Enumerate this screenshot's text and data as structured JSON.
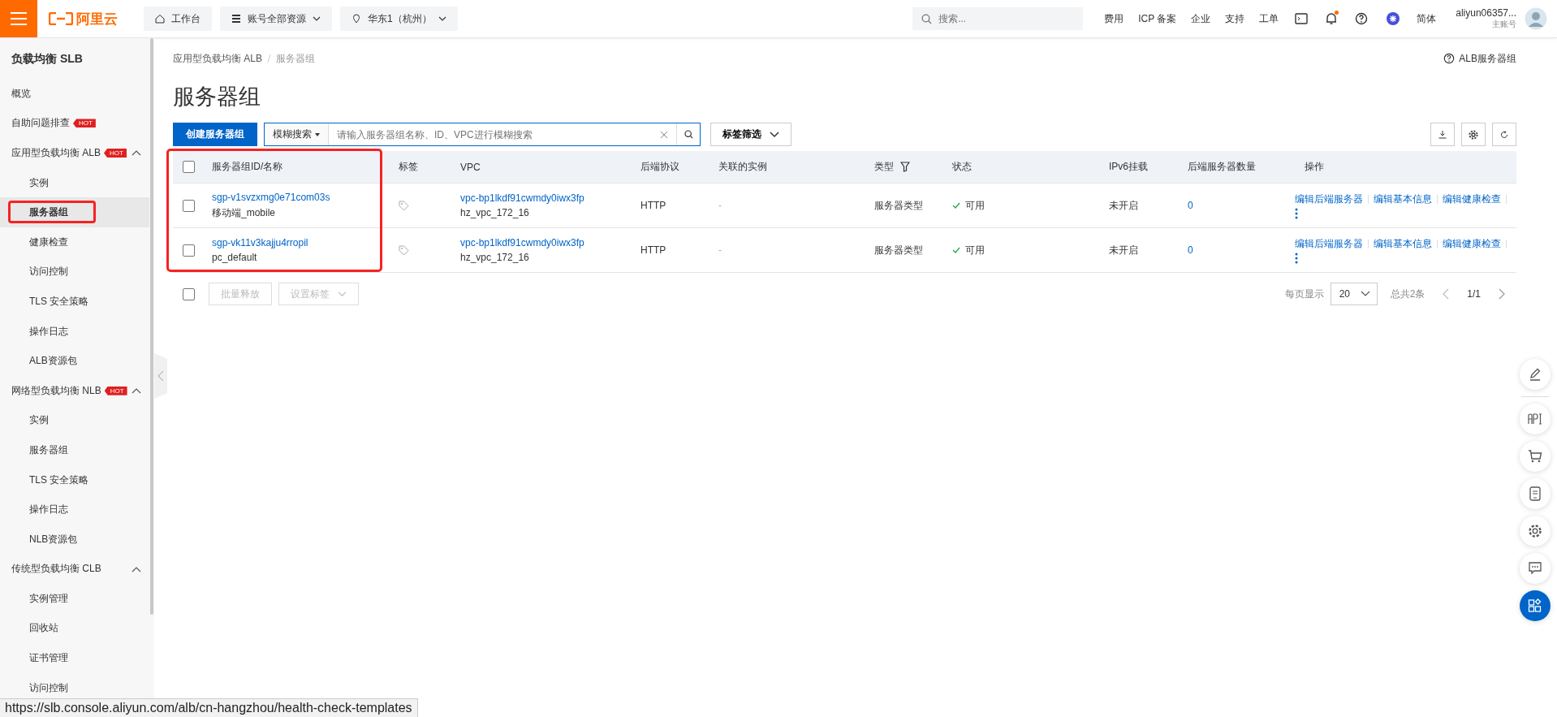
{
  "topbar": {
    "logo": "阿里云",
    "workbench": "工作台",
    "account_scope": "账号全部资源",
    "region": "华东1（杭州）",
    "search": {
      "placeholder": "搜索..."
    },
    "links": [
      "费用",
      "ICP 备案",
      "企业",
      "支持",
      "工单"
    ],
    "language": "简体",
    "notification_dot": true,
    "user": {
      "name": "aliyun06357...",
      "role": "主账号"
    }
  },
  "sidebar": {
    "title": "负载均衡 SLB",
    "items": [
      {
        "label": "概览",
        "selected": false
      },
      {
        "label": "自助问题排查",
        "hot_label": "HOT",
        "selected": false
      },
      {
        "label": "应用型负载均衡 ALB",
        "hot_label": "HOT",
        "expanded": true,
        "children": [
          {
            "label": "实例",
            "selected": false
          },
          {
            "label": "服务器组",
            "selected": true
          },
          {
            "label": "健康检查",
            "selected": false
          },
          {
            "label": "访问控制",
            "selected": false
          },
          {
            "label": "TLS 安全策略",
            "selected": false
          },
          {
            "label": "操作日志",
            "selected": false
          },
          {
            "label": "ALB资源包",
            "selected": false
          }
        ]
      },
      {
        "label": "网络型负载均衡 NLB",
        "hot_label": "HOT",
        "expanded": true,
        "children": [
          {
            "label": "实例",
            "selected": false
          },
          {
            "label": "服务器组",
            "selected": false
          },
          {
            "label": "TLS 安全策略",
            "selected": false
          },
          {
            "label": "操作日志",
            "selected": false
          },
          {
            "label": "NLB资源包",
            "selected": false
          }
        ]
      },
      {
        "label": "传统型负载均衡 CLB",
        "expanded": true,
        "children": [
          {
            "label": "实例管理",
            "selected": false
          },
          {
            "label": "回收站",
            "selected": false
          },
          {
            "label": "证书管理",
            "selected": false
          },
          {
            "label": "访问控制",
            "selected": false
          }
        ]
      }
    ]
  },
  "annotations": {
    "sidebar_item_framed": true,
    "id_column_framed": true
  },
  "breadcrumb": [
    "应用型负载均衡 ALB",
    "服务器组"
  ],
  "help_link": "ALB服务器组",
  "page_title": "服务器组",
  "toolbar": {
    "create_button": "创建服务器组",
    "search_mode": "模糊搜索",
    "search": {
      "placeholder": "请输入服务器组名称、ID、VPC进行模糊搜索"
    },
    "tag_filter": "标签筛选"
  },
  "table": {
    "select_all_checked": false,
    "columns": [
      {
        "label": "服务器组ID/名称"
      },
      {
        "label": "标签"
      },
      {
        "label": "VPC"
      },
      {
        "label": "后端协议"
      },
      {
        "label": "关联的实例"
      },
      {
        "label": "类型",
        "filter": true
      },
      {
        "label": "状态"
      },
      {
        "label": "IPv6挂载"
      },
      {
        "label": "后端服务器数量"
      },
      {
        "label": "操作"
      }
    ],
    "rows": [
      {
        "checked": false,
        "id": "sgp-v1svzxmg0e71com03s",
        "name": "移动端_mobile",
        "vpc_id": "vpc-bp1lkdf91cwmdy0iwx3fp",
        "vpc_name": "hz_vpc_172_16",
        "protocol": "HTTP",
        "instance": "-",
        "type": "服务器类型",
        "status": "可用",
        "ipv6": "未开启",
        "server_count": "0",
        "actions": [
          "编辑后端服务器",
          "编辑基本信息",
          "编辑健康检查"
        ]
      },
      {
        "checked": false,
        "id": "sgp-vk11v3kajju4rropil",
        "name": "pc_default",
        "vpc_id": "vpc-bp1lkdf91cwmdy0iwx3fp",
        "vpc_name": "hz_vpc_172_16",
        "protocol": "HTTP",
        "instance": "-",
        "type": "服务器类型",
        "status": "可用",
        "ipv6": "未开启",
        "server_count": "0",
        "actions": [
          "编辑后端服务器",
          "编辑基本信息",
          "编辑健康检查"
        ]
      }
    ]
  },
  "footer": {
    "select_all_checked": false,
    "bulk_buttons": [
      {
        "label": "批量释放",
        "disabled": true,
        "dropdown": false
      },
      {
        "label": "设置标签",
        "disabled": true,
        "dropdown": true
      }
    ],
    "page_size_label": "每页显示",
    "page_size": "20",
    "total": "总共2条",
    "page": "1/1",
    "prev_disabled": true,
    "next_disabled": false
  },
  "status_url": "https://slb.console.aliyun.com/alb/cn-hangzhou/health-check-templates"
}
